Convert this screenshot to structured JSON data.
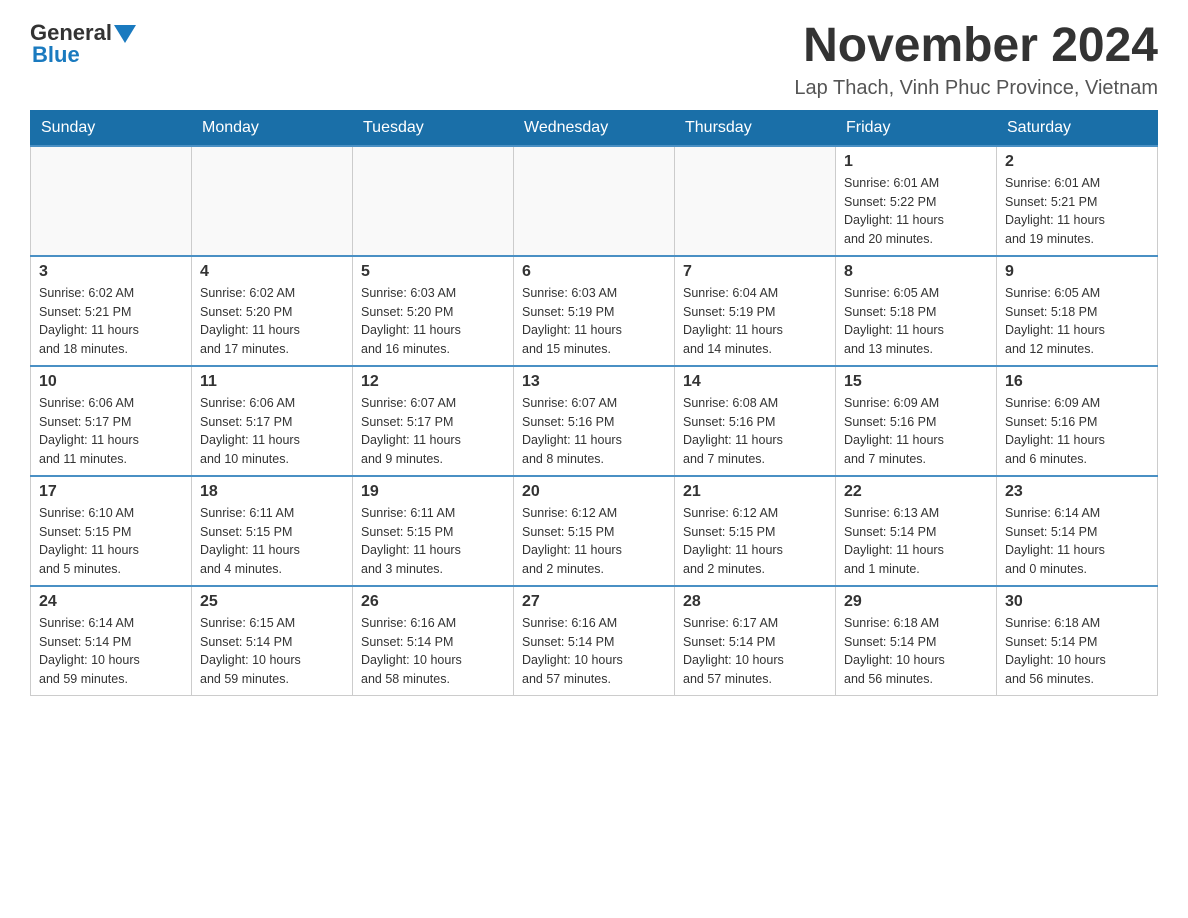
{
  "header": {
    "logo_general": "General",
    "logo_blue": "Blue",
    "month_title": "November 2024",
    "subtitle": "Lap Thach, Vinh Phuc Province, Vietnam"
  },
  "days_of_week": [
    "Sunday",
    "Monday",
    "Tuesday",
    "Wednesday",
    "Thursday",
    "Friday",
    "Saturday"
  ],
  "weeks": [
    {
      "days": [
        {
          "date": "",
          "info": ""
        },
        {
          "date": "",
          "info": ""
        },
        {
          "date": "",
          "info": ""
        },
        {
          "date": "",
          "info": ""
        },
        {
          "date": "",
          "info": ""
        },
        {
          "date": "1",
          "info": "Sunrise: 6:01 AM\nSunset: 5:22 PM\nDaylight: 11 hours\nand 20 minutes."
        },
        {
          "date": "2",
          "info": "Sunrise: 6:01 AM\nSunset: 5:21 PM\nDaylight: 11 hours\nand 19 minutes."
        }
      ]
    },
    {
      "days": [
        {
          "date": "3",
          "info": "Sunrise: 6:02 AM\nSunset: 5:21 PM\nDaylight: 11 hours\nand 18 minutes."
        },
        {
          "date": "4",
          "info": "Sunrise: 6:02 AM\nSunset: 5:20 PM\nDaylight: 11 hours\nand 17 minutes."
        },
        {
          "date": "5",
          "info": "Sunrise: 6:03 AM\nSunset: 5:20 PM\nDaylight: 11 hours\nand 16 minutes."
        },
        {
          "date": "6",
          "info": "Sunrise: 6:03 AM\nSunset: 5:19 PM\nDaylight: 11 hours\nand 15 minutes."
        },
        {
          "date": "7",
          "info": "Sunrise: 6:04 AM\nSunset: 5:19 PM\nDaylight: 11 hours\nand 14 minutes."
        },
        {
          "date": "8",
          "info": "Sunrise: 6:05 AM\nSunset: 5:18 PM\nDaylight: 11 hours\nand 13 minutes."
        },
        {
          "date": "9",
          "info": "Sunrise: 6:05 AM\nSunset: 5:18 PM\nDaylight: 11 hours\nand 12 minutes."
        }
      ]
    },
    {
      "days": [
        {
          "date": "10",
          "info": "Sunrise: 6:06 AM\nSunset: 5:17 PM\nDaylight: 11 hours\nand 11 minutes."
        },
        {
          "date": "11",
          "info": "Sunrise: 6:06 AM\nSunset: 5:17 PM\nDaylight: 11 hours\nand 10 minutes."
        },
        {
          "date": "12",
          "info": "Sunrise: 6:07 AM\nSunset: 5:17 PM\nDaylight: 11 hours\nand 9 minutes."
        },
        {
          "date": "13",
          "info": "Sunrise: 6:07 AM\nSunset: 5:16 PM\nDaylight: 11 hours\nand 8 minutes."
        },
        {
          "date": "14",
          "info": "Sunrise: 6:08 AM\nSunset: 5:16 PM\nDaylight: 11 hours\nand 7 minutes."
        },
        {
          "date": "15",
          "info": "Sunrise: 6:09 AM\nSunset: 5:16 PM\nDaylight: 11 hours\nand 7 minutes."
        },
        {
          "date": "16",
          "info": "Sunrise: 6:09 AM\nSunset: 5:16 PM\nDaylight: 11 hours\nand 6 minutes."
        }
      ]
    },
    {
      "days": [
        {
          "date": "17",
          "info": "Sunrise: 6:10 AM\nSunset: 5:15 PM\nDaylight: 11 hours\nand 5 minutes."
        },
        {
          "date": "18",
          "info": "Sunrise: 6:11 AM\nSunset: 5:15 PM\nDaylight: 11 hours\nand 4 minutes."
        },
        {
          "date": "19",
          "info": "Sunrise: 6:11 AM\nSunset: 5:15 PM\nDaylight: 11 hours\nand 3 minutes."
        },
        {
          "date": "20",
          "info": "Sunrise: 6:12 AM\nSunset: 5:15 PM\nDaylight: 11 hours\nand 2 minutes."
        },
        {
          "date": "21",
          "info": "Sunrise: 6:12 AM\nSunset: 5:15 PM\nDaylight: 11 hours\nand 2 minutes."
        },
        {
          "date": "22",
          "info": "Sunrise: 6:13 AM\nSunset: 5:14 PM\nDaylight: 11 hours\nand 1 minute."
        },
        {
          "date": "23",
          "info": "Sunrise: 6:14 AM\nSunset: 5:14 PM\nDaylight: 11 hours\nand 0 minutes."
        }
      ]
    },
    {
      "days": [
        {
          "date": "24",
          "info": "Sunrise: 6:14 AM\nSunset: 5:14 PM\nDaylight: 10 hours\nand 59 minutes."
        },
        {
          "date": "25",
          "info": "Sunrise: 6:15 AM\nSunset: 5:14 PM\nDaylight: 10 hours\nand 59 minutes."
        },
        {
          "date": "26",
          "info": "Sunrise: 6:16 AM\nSunset: 5:14 PM\nDaylight: 10 hours\nand 58 minutes."
        },
        {
          "date": "27",
          "info": "Sunrise: 6:16 AM\nSunset: 5:14 PM\nDaylight: 10 hours\nand 57 minutes."
        },
        {
          "date": "28",
          "info": "Sunrise: 6:17 AM\nSunset: 5:14 PM\nDaylight: 10 hours\nand 57 minutes."
        },
        {
          "date": "29",
          "info": "Sunrise: 6:18 AM\nSunset: 5:14 PM\nDaylight: 10 hours\nand 56 minutes."
        },
        {
          "date": "30",
          "info": "Sunrise: 6:18 AM\nSunset: 5:14 PM\nDaylight: 10 hours\nand 56 minutes."
        }
      ]
    }
  ]
}
